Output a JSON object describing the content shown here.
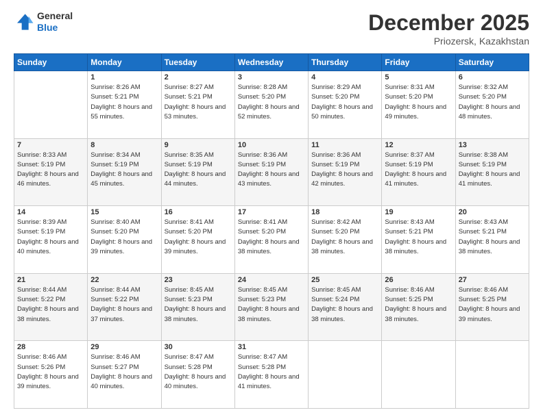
{
  "header": {
    "logo_line1": "General",
    "logo_line2": "Blue",
    "title": "December 2025",
    "subtitle": "Priozersk, Kazakhstan"
  },
  "weekdays": [
    "Sunday",
    "Monday",
    "Tuesday",
    "Wednesday",
    "Thursday",
    "Friday",
    "Saturday"
  ],
  "weeks": [
    [
      {
        "day": "",
        "sunrise": "",
        "sunset": "",
        "daylight": ""
      },
      {
        "day": "1",
        "sunrise": "Sunrise: 8:26 AM",
        "sunset": "Sunset: 5:21 PM",
        "daylight": "Daylight: 8 hours and 55 minutes."
      },
      {
        "day": "2",
        "sunrise": "Sunrise: 8:27 AM",
        "sunset": "Sunset: 5:21 PM",
        "daylight": "Daylight: 8 hours and 53 minutes."
      },
      {
        "day": "3",
        "sunrise": "Sunrise: 8:28 AM",
        "sunset": "Sunset: 5:20 PM",
        "daylight": "Daylight: 8 hours and 52 minutes."
      },
      {
        "day": "4",
        "sunrise": "Sunrise: 8:29 AM",
        "sunset": "Sunset: 5:20 PM",
        "daylight": "Daylight: 8 hours and 50 minutes."
      },
      {
        "day": "5",
        "sunrise": "Sunrise: 8:31 AM",
        "sunset": "Sunset: 5:20 PM",
        "daylight": "Daylight: 8 hours and 49 minutes."
      },
      {
        "day": "6",
        "sunrise": "Sunrise: 8:32 AM",
        "sunset": "Sunset: 5:20 PM",
        "daylight": "Daylight: 8 hours and 48 minutes."
      }
    ],
    [
      {
        "day": "7",
        "sunrise": "Sunrise: 8:33 AM",
        "sunset": "Sunset: 5:19 PM",
        "daylight": "Daylight: 8 hours and 46 minutes."
      },
      {
        "day": "8",
        "sunrise": "Sunrise: 8:34 AM",
        "sunset": "Sunset: 5:19 PM",
        "daylight": "Daylight: 8 hours and 45 minutes."
      },
      {
        "day": "9",
        "sunrise": "Sunrise: 8:35 AM",
        "sunset": "Sunset: 5:19 PM",
        "daylight": "Daylight: 8 hours and 44 minutes."
      },
      {
        "day": "10",
        "sunrise": "Sunrise: 8:36 AM",
        "sunset": "Sunset: 5:19 PM",
        "daylight": "Daylight: 8 hours and 43 minutes."
      },
      {
        "day": "11",
        "sunrise": "Sunrise: 8:36 AM",
        "sunset": "Sunset: 5:19 PM",
        "daylight": "Daylight: 8 hours and 42 minutes."
      },
      {
        "day": "12",
        "sunrise": "Sunrise: 8:37 AM",
        "sunset": "Sunset: 5:19 PM",
        "daylight": "Daylight: 8 hours and 41 minutes."
      },
      {
        "day": "13",
        "sunrise": "Sunrise: 8:38 AM",
        "sunset": "Sunset: 5:19 PM",
        "daylight": "Daylight: 8 hours and 41 minutes."
      }
    ],
    [
      {
        "day": "14",
        "sunrise": "Sunrise: 8:39 AM",
        "sunset": "Sunset: 5:19 PM",
        "daylight": "Daylight: 8 hours and 40 minutes."
      },
      {
        "day": "15",
        "sunrise": "Sunrise: 8:40 AM",
        "sunset": "Sunset: 5:20 PM",
        "daylight": "Daylight: 8 hours and 39 minutes."
      },
      {
        "day": "16",
        "sunrise": "Sunrise: 8:41 AM",
        "sunset": "Sunset: 5:20 PM",
        "daylight": "Daylight: 8 hours and 39 minutes."
      },
      {
        "day": "17",
        "sunrise": "Sunrise: 8:41 AM",
        "sunset": "Sunset: 5:20 PM",
        "daylight": "Daylight: 8 hours and 38 minutes."
      },
      {
        "day": "18",
        "sunrise": "Sunrise: 8:42 AM",
        "sunset": "Sunset: 5:20 PM",
        "daylight": "Daylight: 8 hours and 38 minutes."
      },
      {
        "day": "19",
        "sunrise": "Sunrise: 8:43 AM",
        "sunset": "Sunset: 5:21 PM",
        "daylight": "Daylight: 8 hours and 38 minutes."
      },
      {
        "day": "20",
        "sunrise": "Sunrise: 8:43 AM",
        "sunset": "Sunset: 5:21 PM",
        "daylight": "Daylight: 8 hours and 38 minutes."
      }
    ],
    [
      {
        "day": "21",
        "sunrise": "Sunrise: 8:44 AM",
        "sunset": "Sunset: 5:22 PM",
        "daylight": "Daylight: 8 hours and 38 minutes."
      },
      {
        "day": "22",
        "sunrise": "Sunrise: 8:44 AM",
        "sunset": "Sunset: 5:22 PM",
        "daylight": "Daylight: 8 hours and 37 minutes."
      },
      {
        "day": "23",
        "sunrise": "Sunrise: 8:45 AM",
        "sunset": "Sunset: 5:23 PM",
        "daylight": "Daylight: 8 hours and 38 minutes."
      },
      {
        "day": "24",
        "sunrise": "Sunrise: 8:45 AM",
        "sunset": "Sunset: 5:23 PM",
        "daylight": "Daylight: 8 hours and 38 minutes."
      },
      {
        "day": "25",
        "sunrise": "Sunrise: 8:45 AM",
        "sunset": "Sunset: 5:24 PM",
        "daylight": "Daylight: 8 hours and 38 minutes."
      },
      {
        "day": "26",
        "sunrise": "Sunrise: 8:46 AM",
        "sunset": "Sunset: 5:25 PM",
        "daylight": "Daylight: 8 hours and 38 minutes."
      },
      {
        "day": "27",
        "sunrise": "Sunrise: 8:46 AM",
        "sunset": "Sunset: 5:25 PM",
        "daylight": "Daylight: 8 hours and 39 minutes."
      }
    ],
    [
      {
        "day": "28",
        "sunrise": "Sunrise: 8:46 AM",
        "sunset": "Sunset: 5:26 PM",
        "daylight": "Daylight: 8 hours and 39 minutes."
      },
      {
        "day": "29",
        "sunrise": "Sunrise: 8:46 AM",
        "sunset": "Sunset: 5:27 PM",
        "daylight": "Daylight: 8 hours and 40 minutes."
      },
      {
        "day": "30",
        "sunrise": "Sunrise: 8:47 AM",
        "sunset": "Sunset: 5:28 PM",
        "daylight": "Daylight: 8 hours and 40 minutes."
      },
      {
        "day": "31",
        "sunrise": "Sunrise: 8:47 AM",
        "sunset": "Sunset: 5:28 PM",
        "daylight": "Daylight: 8 hours and 41 minutes."
      },
      {
        "day": "",
        "sunrise": "",
        "sunset": "",
        "daylight": ""
      },
      {
        "day": "",
        "sunrise": "",
        "sunset": "",
        "daylight": ""
      },
      {
        "day": "",
        "sunrise": "",
        "sunset": "",
        "daylight": ""
      }
    ]
  ]
}
